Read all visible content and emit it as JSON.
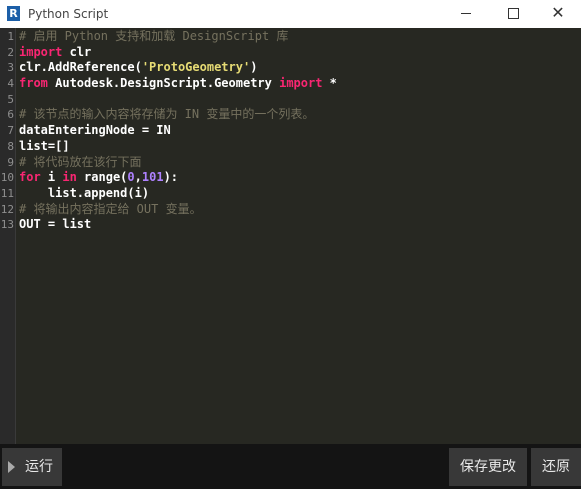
{
  "window": {
    "title": "Python Script",
    "icon_letter": "R",
    "icon": "revit-r-icon"
  },
  "controls": {
    "minimize": "minimize-icon",
    "maximize": "maximize-icon",
    "close_glyph": "✕"
  },
  "editor": {
    "lines": [
      {
        "n": "1",
        "tokens": [
          {
            "t": "# 启用 Python 支持和加载 DesignScript 库",
            "c": "cm"
          }
        ]
      },
      {
        "n": "2",
        "tokens": [
          {
            "t": "import",
            "c": "kw"
          },
          {
            "t": " clr",
            "c": ""
          }
        ]
      },
      {
        "n": "3",
        "tokens": [
          {
            "t": "clr.AddReference(",
            "c": ""
          },
          {
            "t": "'ProtoGeometry'",
            "c": "str"
          },
          {
            "t": ")",
            "c": ""
          }
        ]
      },
      {
        "n": "4",
        "tokens": [
          {
            "t": "from",
            "c": "kw"
          },
          {
            "t": " Autodesk.DesignScript.Geometry ",
            "c": ""
          },
          {
            "t": "import",
            "c": "kw"
          },
          {
            "t": " *",
            "c": ""
          }
        ]
      },
      {
        "n": "5",
        "tokens": []
      },
      {
        "n": "6",
        "tokens": [
          {
            "t": "# 该节点的输入内容将存储为 IN 变量中的一个列表。",
            "c": "cm"
          }
        ]
      },
      {
        "n": "7",
        "tokens": [
          {
            "t": "dataEnteringNode = IN",
            "c": ""
          }
        ]
      },
      {
        "n": "8",
        "tokens": [
          {
            "t": "list=[]",
            "c": ""
          }
        ]
      },
      {
        "n": "9",
        "tokens": [
          {
            "t": "# 将代码放在该行下面",
            "c": "cm"
          }
        ]
      },
      {
        "n": "10",
        "tokens": [
          {
            "t": "for",
            "c": "kw"
          },
          {
            "t": " i ",
            "c": ""
          },
          {
            "t": "in",
            "c": "kw"
          },
          {
            "t": " range(",
            "c": ""
          },
          {
            "t": "0",
            "c": "num"
          },
          {
            "t": ",",
            "c": ""
          },
          {
            "t": "101",
            "c": "num"
          },
          {
            "t": "):",
            "c": ""
          }
        ]
      },
      {
        "n": "11",
        "tokens": [
          {
            "t": "    list.append(i)",
            "c": ""
          }
        ]
      },
      {
        "n": "12",
        "tokens": [
          {
            "t": "# 将输出内容指定给 OUT 变量。",
            "c": "cm"
          }
        ]
      },
      {
        "n": "13",
        "tokens": [
          {
            "t": "OUT = list",
            "c": ""
          }
        ]
      }
    ]
  },
  "footer": {
    "run_label": "运行",
    "run_icon": "play-icon",
    "save_label": "保存更改",
    "revert_label": "还原"
  },
  "colors": {
    "editor_bg": "#272822",
    "keyword": "#f92672",
    "comment": "#75715e",
    "string": "#e6db74",
    "number": "#ae81ff"
  }
}
